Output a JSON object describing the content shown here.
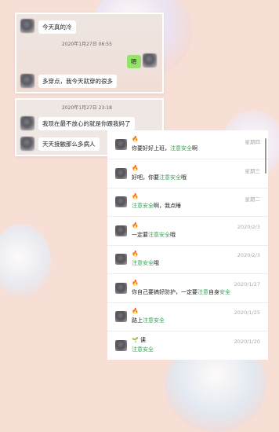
{
  "chat_top": {
    "messages": [
      {
        "text": "今天真的冷",
        "from": "other"
      },
      {
        "text": "嗯",
        "from": "self"
      },
      {
        "text": "多穿点，我今天就穿的很多",
        "from": "other"
      }
    ],
    "timestamp": "2020年1月27日 06:55"
  },
  "chat_second": {
    "timestamp": "2020年1月27日 23:18",
    "messages": [
      {
        "text": "我现在最不放心的就是你跟我妈了",
        "from": "other"
      },
      {
        "text": "天天接触那么多病人",
        "from": "other"
      }
    ]
  },
  "search_results": {
    "nickname_emoji": "🔥",
    "nickname_alt": "🌱 读",
    "highlight": "注意安全",
    "rows": [
      {
        "pre": "你要好好上班，",
        "hl": "注意安全",
        "post": "啊",
        "date": "星期四"
      },
      {
        "pre": "好吧，你要",
        "hl": "注意安全",
        "post": "哦",
        "date": "星期三"
      },
      {
        "pre": "",
        "hl": "注意安全",
        "post": "啊，我点睡",
        "date": "星期二"
      },
      {
        "pre": "一定要",
        "hl": "注意安全",
        "post": "哦",
        "date": "2020/2/3"
      },
      {
        "pre": "",
        "hl": "注意安全",
        "post": "哦",
        "date": "2020/2/3"
      },
      {
        "pre": "你自己要搞好防护，一定要",
        "hl": "注意",
        "post": "自身",
        "hl2": "安全",
        "date": "2020/1/27"
      },
      {
        "pre": "路上",
        "hl": "注意安全",
        "post": "",
        "date": "2020/1/25"
      },
      {
        "pre": "",
        "hl": "注意安全",
        "post": "",
        "date": "2020/1/20"
      }
    ]
  },
  "colors": {
    "highlight": "#3aa35a",
    "self_bubble": "#95e16c",
    "background": "#f7dfd6"
  }
}
